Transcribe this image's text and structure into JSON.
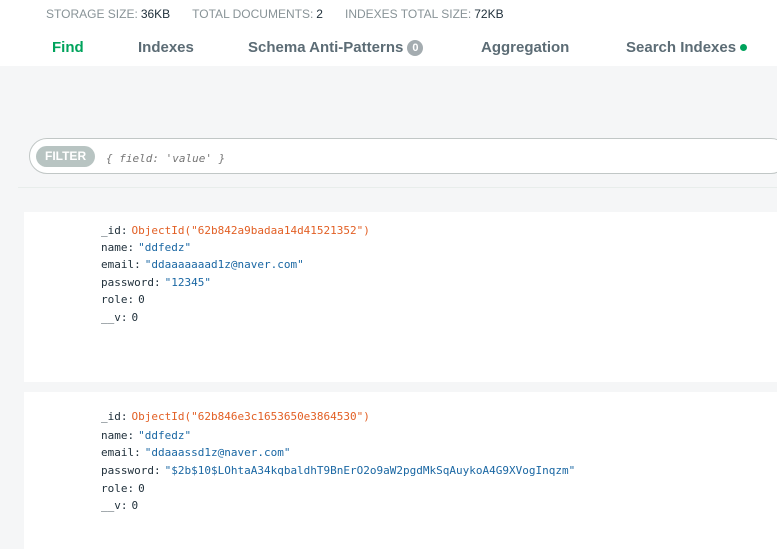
{
  "stats": [
    {
      "label": "STORAGE SIZE:",
      "value": "36KB"
    },
    {
      "label": "TOTAL DOCUMENTS:",
      "value": "2"
    },
    {
      "label": "INDEXES TOTAL SIZE:",
      "value": "72KB"
    }
  ],
  "tabs": {
    "find": "Find",
    "indexes": "Indexes",
    "schema": "Schema Anti-Patterns",
    "schema_count": "0",
    "aggregation": "Aggregation",
    "search": "Search Indexes"
  },
  "filter": {
    "label": "FILTER",
    "placeholder": "{ field: 'value' }"
  },
  "documents": [
    {
      "fields": [
        {
          "key": "_id",
          "value": "ObjectId(\"62b842a9badaa14d41521352\")"
        },
        {
          "key": "name",
          "value": "\"ddfedz\""
        },
        {
          "key": "email",
          "value": "\"ddaaaaaaad1z@naver.com\""
        },
        {
          "key": "password",
          "value": "\"12345\""
        },
        {
          "key": "role",
          "value": "0"
        },
        {
          "key": "__v",
          "value": "0"
        }
      ]
    },
    {
      "fields": [
        {
          "key": "_id",
          "value": "ObjectId(\"62b846e3c1653650e3864530\")"
        },
        {
          "key": "name",
          "value": "\"ddfedz\""
        },
        {
          "key": "email",
          "value": "\"ddaaassd1z@naver.com\""
        },
        {
          "key": "password",
          "value": "\"$2b$10$LOhtaA34kqbaldhT9BnErO2o9aW2pgdMkSqAuykoA4G9XVogInqzm\""
        },
        {
          "key": "role",
          "value": "0"
        },
        {
          "key": "__v",
          "value": "0"
        }
      ]
    }
  ],
  "colors": {
    "accent": "#00a35c",
    "objectid": "#e25f24",
    "string": "#1a67a3"
  }
}
